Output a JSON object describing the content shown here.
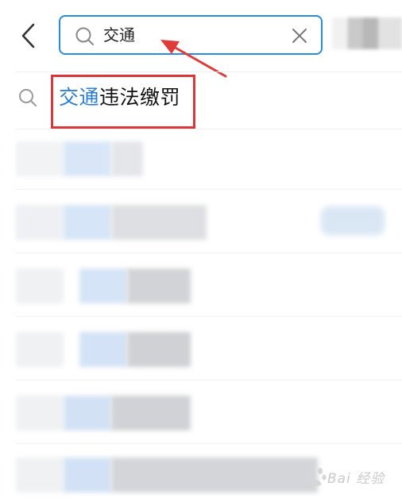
{
  "search": {
    "query": "交通",
    "placeholder": ""
  },
  "suggestion": {
    "highlight": "交通",
    "rest": "违法缴罚"
  },
  "colors": {
    "accent": "#2b8ad9",
    "annotation_red": "#d9383a"
  },
  "icons": {
    "back": "chevron-left-icon",
    "search": "search-icon",
    "clear": "close-icon"
  },
  "watermark": {
    "text": "Bai 经验"
  }
}
